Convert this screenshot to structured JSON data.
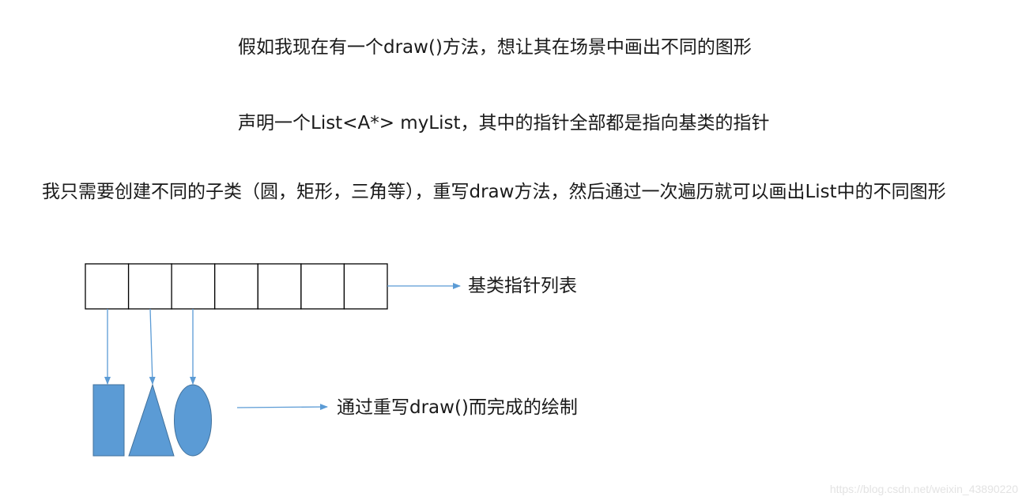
{
  "text_lines": [
    "假如我现在有一个draw()方法，想让其在场景中画出不同的图形",
    "声明一个List<A*> myList，其中的指针全部都是指向基类的指针",
    "我只需要创建不同的子类（圆，矩形，三角等），重写draw方法，然后通过一次遍历就可以画出List中的不同图形"
  ],
  "diagram": {
    "list_label": "基类指针列表",
    "list_cell_count": 7,
    "shapes": [
      {
        "type": "rectangle",
        "name": "rectangle-shape"
      },
      {
        "type": "triangle",
        "name": "triangle-shape"
      },
      {
        "type": "ellipse",
        "name": "ellipse-shape"
      }
    ],
    "draw_label": "通过重写draw()而完成的绘制"
  },
  "colors": {
    "shape_fill": "#5b9bd5",
    "shape_stroke": "#41719c",
    "arrow": "#5b9bd5",
    "box_stroke": "#000000",
    "text": "#1a1a1a"
  },
  "watermark": "https://blog.csdn.net/weixin_43890220"
}
